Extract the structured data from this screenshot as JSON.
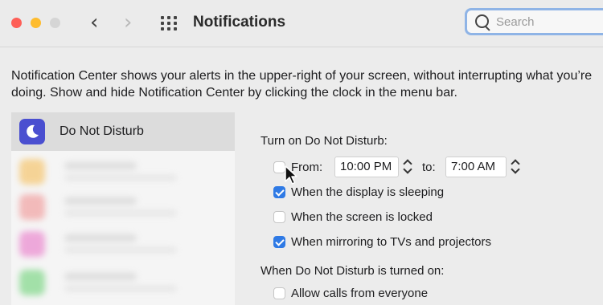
{
  "window": {
    "title": "Notifications",
    "search_placeholder": "Search"
  },
  "description": {
    "line1": "Notification Center shows your alerts in the upper-right of your screen, without interrupting what you’re",
    "line2": "doing. Show and hide Notification Center by clicking the clock in the menu bar."
  },
  "sidebar": {
    "selected_item": {
      "label": "Do Not Disturb",
      "icon": "moon-icon",
      "icon_color": "#4a4fd0"
    },
    "blurred_icon_colors": [
      "#f6b94a",
      "#f08a8a",
      "#e86ac4",
      "#5fcf6a"
    ]
  },
  "dnd": {
    "turn_on_label": "Turn on Do Not Disturb:",
    "from": {
      "label": "From:",
      "checked": false,
      "time": "10:00 PM"
    },
    "to": {
      "label": "to:",
      "time": "7:00 AM"
    },
    "options": [
      {
        "label": "When the display is sleeping",
        "checked": true
      },
      {
        "label": "When the screen is locked",
        "checked": false
      },
      {
        "label": "When mirroring to TVs and projectors",
        "checked": true
      }
    ],
    "when_on_label": "When Do Not Disturb is turned on:",
    "when_on_options": [
      {
        "label": "Allow calls from everyone",
        "checked": false
      }
    ]
  },
  "colors": {
    "accent": "#2f7ae5",
    "search_focus": "#8fb4e6"
  }
}
